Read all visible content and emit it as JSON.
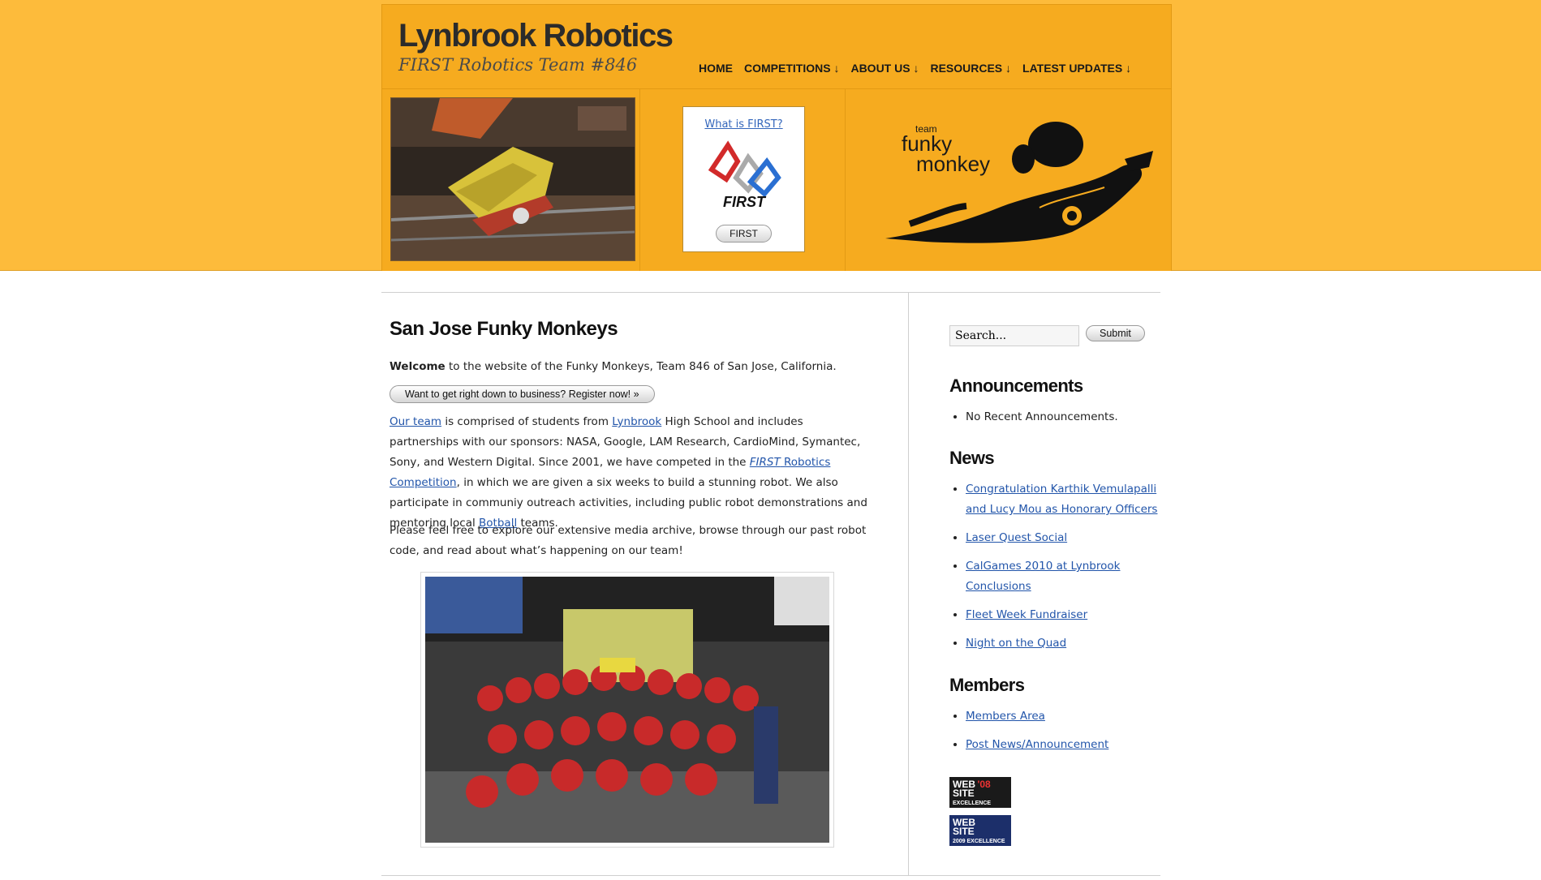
{
  "header": {
    "site_title": "Lynbrook Robotics",
    "tagline": "FIRST Robotics Team #846",
    "nav": [
      {
        "label": "HOME"
      },
      {
        "label": "COMPETITIONS ↓"
      },
      {
        "label": "ABOUT US ↓"
      },
      {
        "label": "RESOURCES ↓"
      },
      {
        "label": "LATEST UPDATES ↓"
      }
    ],
    "first_box": {
      "link": "What is FIRST?",
      "logo_text": "FIRST",
      "button": "FIRST"
    },
    "logo": {
      "team": "team",
      "name_line1": "funky",
      "name_line2": "monkey"
    }
  },
  "main": {
    "title": "San Jose Funky Monkeys",
    "welcome_bold": "Welcome",
    "welcome_rest": " to the website of the Funky Monkeys, Team 846 of San Jose, California.",
    "register_button": "Want to get right down to business? Register now! »",
    "p2": {
      "link_team": "Our team",
      "t1": " is comprised of students from ",
      "link_school": "Lynbrook",
      "t2": " High School and includes partnerships with our sponsors: NASA, Google, LAM Research, CardioMind, Symantec, Sony, and Western Digital. Since 2001, we have competed in the ",
      "link_first_em": "FIRST",
      "link_first_rest": " Robotics Competition",
      "t3": ", in which we are given a six weeks to build a stunning robot. We also participate in communiy outreach activities, including public robot demonstrations and mentoring local ",
      "link_botball": "Botball",
      "t4": " teams."
    },
    "p3": "Please feel free to explore our extensive media archive, browse through our past robot code, and read about what’s happening on our team!"
  },
  "sidebar": {
    "search_placeholder": "Search...",
    "search_button": "Submit",
    "announcements_title": "Announcements",
    "announcements": [
      "No Recent Announcements."
    ],
    "news_title": "News",
    "news": [
      "Congratulation Karthik Vemulapalli and Lucy Mou as Honorary Officers",
      "Laser Quest Social",
      "CalGames 2010 at Lynbrook Conclusions",
      "Fleet Week Fundraiser",
      "Night on the Quad"
    ],
    "members_title": "Members",
    "members": [
      "Members Area",
      "Post News/Announcement"
    ],
    "badges": [
      {
        "line1": "WEB",
        "line2": "SITE",
        "line3": "EXCELLENCE AWARD",
        "year": "'08"
      },
      {
        "line1": "WEB",
        "line2": "SITE",
        "line3": "2009 EXCELLENCE AWARD",
        "year": ""
      }
    ]
  },
  "colors": {
    "header_bg": "#f6ab1f",
    "band_bg": "#fdbb3b",
    "link": "#2255aa"
  }
}
